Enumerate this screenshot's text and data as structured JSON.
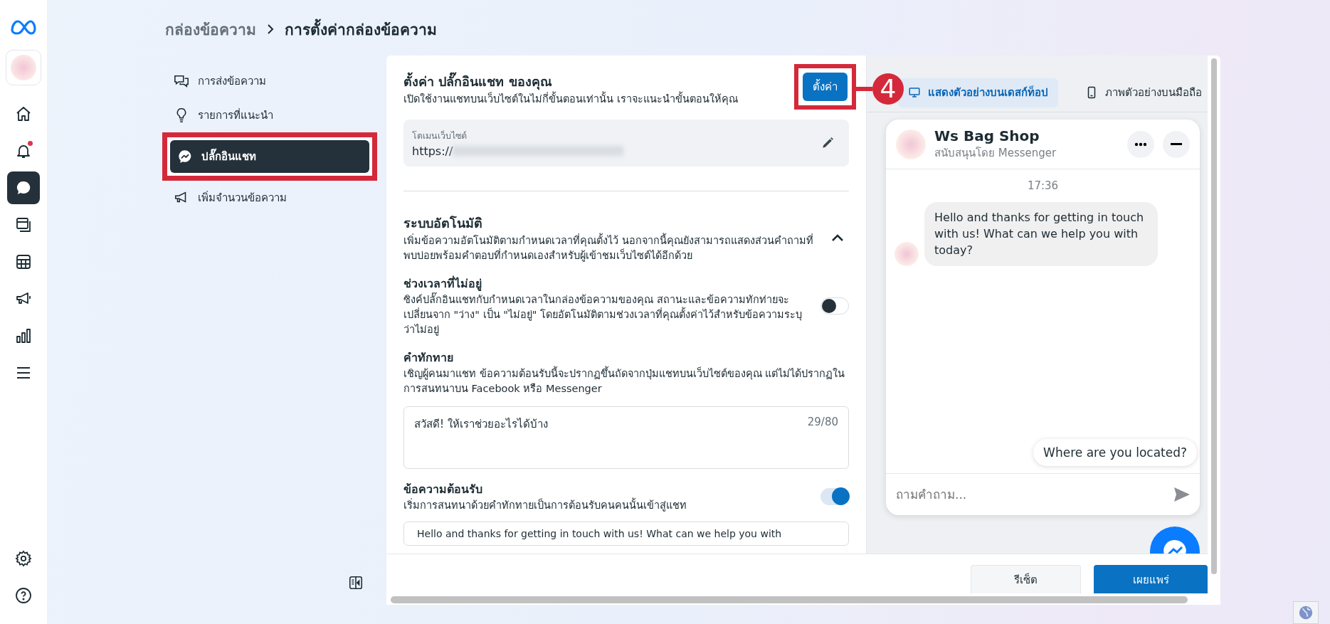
{
  "rail": {
    "items": [
      {
        "kind": "home",
        "selected": false,
        "dot": false
      },
      {
        "kind": "bell",
        "selected": false,
        "dot": true
      },
      {
        "kind": "chat",
        "selected": true,
        "dot": false
      },
      {
        "kind": "pages",
        "selected": false,
        "dot": false
      },
      {
        "kind": "table",
        "selected": false,
        "dot": false
      },
      {
        "kind": "megaphone",
        "selected": false,
        "dot": false
      },
      {
        "kind": "chart",
        "selected": false,
        "dot": false
      },
      {
        "kind": "menu",
        "selected": false,
        "dot": false
      }
    ],
    "bottom": [
      {
        "kind": "gear"
      },
      {
        "kind": "help"
      }
    ]
  },
  "breadcrumb": [
    "กล่องข้อความ",
    "การตั้งค่ากล่องข้อความ"
  ],
  "settings_nav": [
    {
      "kind": "chats",
      "label": "การส่งข้อความ",
      "selected": false,
      "annotated": false
    },
    {
      "kind": "bulb",
      "label": "รายการที่แนะนำ",
      "selected": false,
      "annotated": false
    },
    {
      "kind": "messenger",
      "label": "ปลั๊กอินแชท",
      "selected": true,
      "annotated": true
    },
    {
      "kind": "megaphone",
      "label": "เพิ่มจำนวนข้อความ",
      "selected": false,
      "annotated": false
    }
  ],
  "plugin": {
    "title": "ตั้งค่า ปลั๊กอินแชท ของคุณ",
    "subtitle": "เปิดใช้งานแชทบนเว็บไซต์ในไม่กี่ขั้นตอนเท่านั้น เราจะแนะนำขั้นตอนให้คุณ",
    "setup_button": {
      "label": "ตั้งค่า",
      "annotated": true
    },
    "callout": "4",
    "domain": {
      "label": "โดเมนเว็บไซต์",
      "value": "https://"
    }
  },
  "automation": {
    "title": "ระบบอัตโนมัติ",
    "description": "เพิ่มข้อความอัตโนมัติตามกำหนดเวลาที่คุณตั้งไว้ นอกจากนี้คุณยังสามารถแสดงส่วนคำถามที่พบบ่อยพร้อมคำตอบที่กำหนดเองสำหรับผู้เข้าชมเว็บไซต์ได้อีกด้วย",
    "expanded": true,
    "sections": [
      {
        "kind": "toggle",
        "title": "ช่วงเวลาที่ไม่อยู่",
        "description": "ซิงค์ปลั๊กอินแชทกับกำหนดเวลาในกล่องข้อความของคุณ สถานะและข้อความทักท่ายจะเปลี่ยนจาก \"ว่าง\" เป็น \"ไม่อยู่\" โดยอัตโนมัติตามช่วงเวลาที่คุณตั้งค่าไว้สำหรับข้อความระบุว่าไม่อยู่",
        "on": false
      },
      {
        "kind": "textarea",
        "title": "คำทักทาย",
        "description": "เชิญผู้คนมาแชท ข้อความต้อนรับนี้จะปรากฏขึ้นถัดจากปุ่มแชทบนเว็บไซต์ของคุณ แต่ไม่ได้ปรากฏในการสนทนาบน Facebook หรือ Messenger",
        "value": "สวัสดี! ให้เราช่วยอะไรได้บ้าง",
        "counter": "29/80"
      },
      {
        "kind": "toggle",
        "title": "ข้อความต้อนรับ",
        "description": "เริ่มการสนทนาด้วยคำทักทายเป็นการต้อนรับคนคนนั้นเข้าสู่แชท",
        "on": true
      },
      {
        "kind": "field",
        "value": "Hello and thanks for getting in touch with us! What can we help you with"
      }
    ]
  },
  "preview": {
    "tabs": [
      {
        "kind": "desktop",
        "label": "แสดงตัวอย่างบนเดสก์ท็อป",
        "selected": true
      },
      {
        "kind": "mobile",
        "label": "ภาพตัวอย่างบนมือถือ",
        "selected": false
      }
    ],
    "chat": {
      "name": "Ws Bag Shop",
      "subtitle": "สนับสนุนโดย Messenger",
      "time": "17:36",
      "message": "Hello and thanks for getting in touch with us! What can we help you with today?",
      "quick_reply": "Where are you located?",
      "input_placeholder": "ถามคำถาม..."
    }
  },
  "footer": {
    "buttons": [
      {
        "kind": "secondary",
        "label": "รีเซ็ต"
      },
      {
        "kind": "primary",
        "label": "เผยแพร่"
      }
    ]
  }
}
